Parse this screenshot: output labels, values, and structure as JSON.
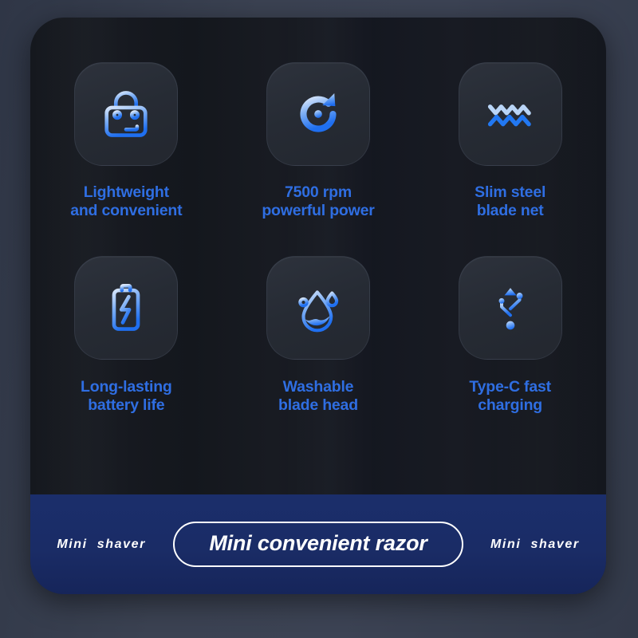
{
  "theme": {
    "page_background": "#3a4152",
    "card_background": "#16191f",
    "tile_background": "#2b3038",
    "label_color": "#2f6ee2",
    "footer_background": "#1b2e6b",
    "footer_text_color": "#ffffff",
    "icon_gradient_from": "#cfe0f7",
    "icon_gradient_to": "#1f6ff0"
  },
  "features": [
    {
      "icon": "shopping-bag-icon",
      "label": "Lightweight\nand convenient"
    },
    {
      "icon": "rotate-refresh-icon",
      "label": "7500 rpm\npowerful power"
    },
    {
      "icon": "zigzag-blade-net-icon",
      "label": "Slim steel\nblade net"
    },
    {
      "icon": "battery-charge-icon",
      "label": "Long-lasting\nbattery life"
    },
    {
      "icon": "water-drop-icon",
      "label": "Washable\nblade head"
    },
    {
      "icon": "usb-icon",
      "label": "Type-C fast\ncharging"
    }
  ],
  "footer": {
    "left_text": "Mini  shaver",
    "pill_text": "Mini convenient razor",
    "right_text": "Mini  shaver"
  }
}
